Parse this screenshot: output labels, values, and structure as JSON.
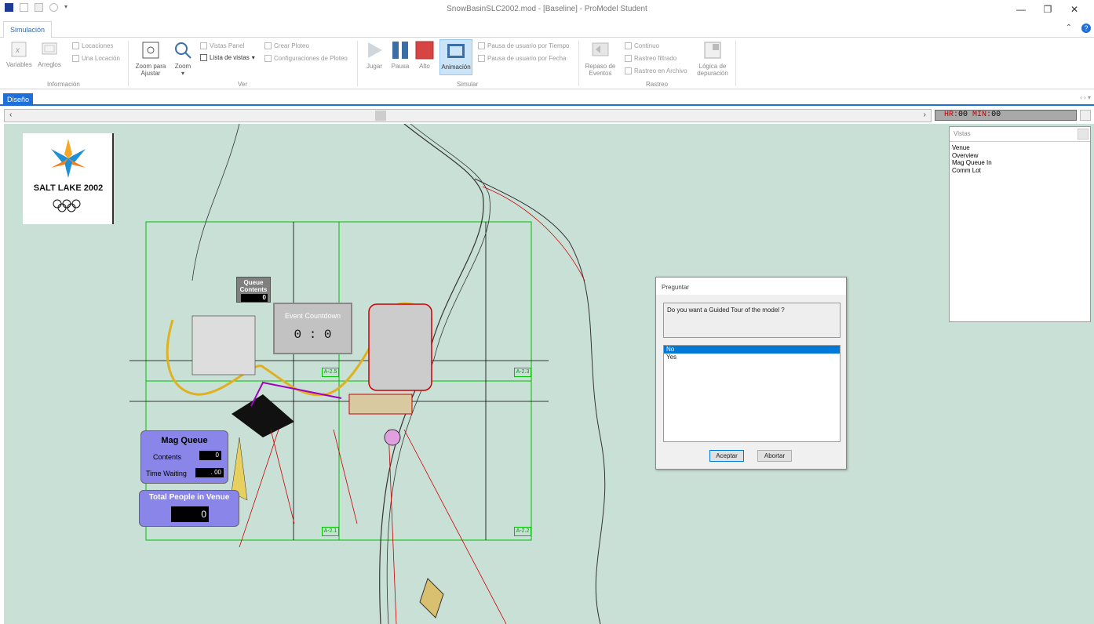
{
  "window": {
    "title": "SnowBasinSLC2002.mod - [Baseline] - ProModel Student",
    "controls": [
      "—",
      "❐",
      "✕"
    ]
  },
  "ribbon": {
    "tab": "Simulación",
    "groups": {
      "informacion": {
        "label": "Información",
        "variables": "Variables",
        "arreglos": "Arreglos",
        "locaciones": "Locaciones",
        "una_locacion": "Una Locación"
      },
      "ver": {
        "label": "Ver",
        "zoom_ajustar_1": "Zoom para",
        "zoom_ajustar_2": "Ajustar",
        "zoom": "Zoom",
        "vistas_panel": "Vistas Panel",
        "lista_vistas": "Lista de vistas",
        "crear_ploteo": "Crear Ploteo",
        "config_ploteo": "Configuraciones de Ploteo"
      },
      "simular": {
        "label": "Simular",
        "jugar": "Jugar",
        "pausa": "Pausa",
        "alto": "Alto",
        "animacion": "Animación",
        "pausa_tiempo": "Pausa de usuario por Tiempo",
        "pausa_fecha": "Pausa de usuario por Fecha"
      },
      "rastreo": {
        "label": "Rastreo",
        "repaso_1": "Repaso de",
        "repaso_2": "Eventos",
        "continuo": "Continuo",
        "filtrado": "Rastreo filtrado",
        "archivo": "Rastreo en Archivo",
        "logica_1": "Lógica de",
        "logica_2": "depuración"
      }
    }
  },
  "doc_tab": "Diseño",
  "clock": {
    "hr_label": "HR:",
    "hr": "00",
    "min_label": "MIN:",
    "min": "00"
  },
  "views_panel": {
    "title": "Vistas",
    "items": [
      "Venue",
      "Overview",
      "Mag Queue In",
      "Comm Lot"
    ]
  },
  "logo": {
    "text": "SALT LAKE 2002"
  },
  "queue_box": {
    "label_1": "Queue",
    "label_2": "Contents",
    "value": "0"
  },
  "countdown": {
    "title": "Event Countdown",
    "value": "0 : 0"
  },
  "mag_queue": {
    "title": "Mag Queue",
    "contents_label": "Contents",
    "contents": "0",
    "time_label": "Time Waiting",
    "time": ". 00"
  },
  "people": {
    "title": "Total People in Venue",
    "value": "0"
  },
  "grid_labels": [
    "A-2.5",
    "A-2.3",
    "A-2.1",
    "A-2.2"
  ],
  "dialog": {
    "title": "Preguntar",
    "message": "Do you want a Guided Tour of the model ?",
    "options": [
      "No",
      "Yes"
    ],
    "ok": "Aceptar",
    "cancel": "Abortar"
  },
  "colors": {
    "accent": "#1e6fd9",
    "canvas": "#c9e0d7",
    "panel_purple": "#8a85e8",
    "clock_red": "#c00000"
  }
}
